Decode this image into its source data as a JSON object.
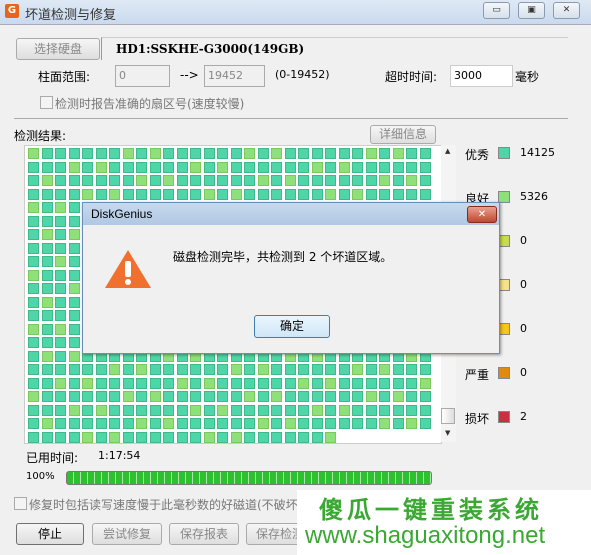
{
  "window": {
    "title": "坏道检测与修复",
    "logo": "G",
    "min": "▭",
    "max": "▣",
    "close": "✕"
  },
  "disk": {
    "select_button": "选择硬盘",
    "info": "HD1:SSKHE-G3000(149GB)"
  },
  "range": {
    "label": "柱面范围:",
    "from": "0",
    "arrow": "-->",
    "to": "19452",
    "hint": "(0-19452)",
    "timeout_label": "超时时间:",
    "timeout_value": "3000",
    "timeout_unit": "毫秒"
  },
  "report_sector_checkbox": {
    "label": "检测时报告准确的扇区号(速度较慢)",
    "checked": false
  },
  "results": {
    "label": "检测结果:",
    "details_button": "详细信息"
  },
  "legend": [
    {
      "label": "优秀",
      "color": "#4fd6a8",
      "count": "14125"
    },
    {
      "label": "良好",
      "color": "#8ee07a",
      "count": "5326"
    },
    {
      "label": "",
      "color": "#c8dc50",
      "count": "0"
    },
    {
      "label": "",
      "color": "#f6e28a",
      "count": "0"
    },
    {
      "label": "",
      "color": "#f5c816",
      "count": "0"
    },
    {
      "label": "严重",
      "color": "#e08a10",
      "count": "0"
    },
    {
      "label": "损坏",
      "color": "#cc3040",
      "count": "2"
    }
  ],
  "elapsed": {
    "label": "已用时间:",
    "value": "1:17:54"
  },
  "progress": {
    "label": "100%",
    "percent": 100
  },
  "repair_checkbox": {
    "label": "修复时包括读写速度慢于此毫秒数的好磁道(不破坏数据):",
    "checked": false
  },
  "buttons": {
    "stop": "停止",
    "try_repair": "尝试修复",
    "save_report": "保存报表",
    "save_info": "保存检测信息"
  },
  "dialog": {
    "title": "DiskGenius",
    "message": "磁盘检测完毕，共检测到 2 个坏道区域。",
    "ok": "确定",
    "icon": "warning-icon"
  },
  "watermark": {
    "line1": "傻瓜一键重装系统",
    "line2": "www.shaguaxitong.net"
  }
}
